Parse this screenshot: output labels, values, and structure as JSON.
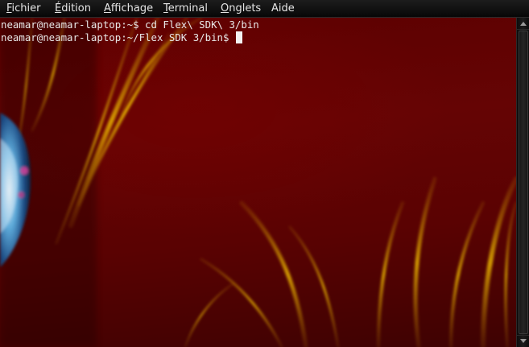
{
  "menubar": {
    "items": [
      {
        "mnemonic": "F",
        "rest": "ichier"
      },
      {
        "mnemonic": "É",
        "rest": "dition"
      },
      {
        "mnemonic": "A",
        "rest": "ffichage"
      },
      {
        "mnemonic": "T",
        "rest": "erminal"
      },
      {
        "mnemonic": "O",
        "rest": "nglets"
      },
      {
        "mnemonic": "",
        "rest": "Aide"
      }
    ]
  },
  "terminal": {
    "lines": [
      "neamar@neamar-laptop:~$ cd Flex\\ SDK\\ 3/bin",
      "neamar@neamar-laptop:~/Flex SDK 3/bin$ "
    ]
  },
  "icons": {
    "scroll_up": "arrow-up-icon",
    "scroll_down": "arrow-down-icon"
  },
  "colors": {
    "menubar_background": "#0f0f0f",
    "menu_text": "#e4e4e4",
    "terminal_background": "#5c0000",
    "terminal_text": "#e8e8e8",
    "wallpaper_streak": "#e8b400"
  }
}
